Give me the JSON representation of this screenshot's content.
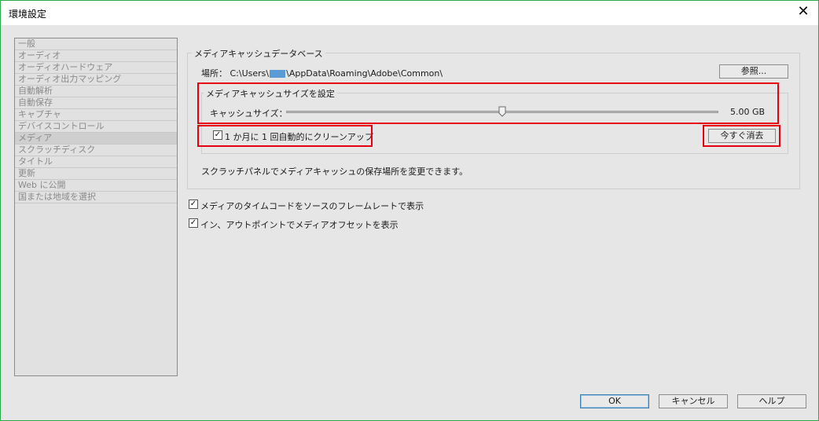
{
  "window": {
    "title": "環境設定",
    "close_glyph": "✕"
  },
  "sidebar": {
    "items": [
      {
        "label": "一般"
      },
      {
        "label": "オーディオ"
      },
      {
        "label": "オーディオハードウェア"
      },
      {
        "label": "オーディオ出力マッピング"
      },
      {
        "label": "自動解析"
      },
      {
        "label": "自動保存"
      },
      {
        "label": "キャプチャ"
      },
      {
        "label": "デバイスコントロール"
      },
      {
        "label": "メディア"
      },
      {
        "label": "スクラッチディスク"
      },
      {
        "label": "タイトル"
      },
      {
        "label": "更新"
      },
      {
        "label": "Web に公開"
      },
      {
        "label": "国または地域を選択"
      }
    ],
    "selected": "メディア"
  },
  "media_cache_db": {
    "group_title": "メディアキャッシュデータベース",
    "location_label": "場所：",
    "location_prefix": "C:\\Users\\",
    "location_suffix": "\\AppData\\Roaming\\Adobe\\Common\\",
    "browse_button": "参照..."
  },
  "cache_size": {
    "group_title": "メディアキャッシュサイズを設定",
    "size_label": "キャッシュサイズ：",
    "size_value": "5.00 GB",
    "slider_fraction": 0.5
  },
  "auto_clean": {
    "label": "1 か月に 1 回自動的にクリーンアップ",
    "checked": true,
    "clean_now_button": "今すぐ消去"
  },
  "scratch_note": "スクラッチパネルでメディアキャッシュの保存場所を変更できます。",
  "options": [
    {
      "label": "メディアのタイムコードをソースのフレームレートで表示",
      "checked": true
    },
    {
      "label": "イン、アウトポイントでメディアオフセットを表示",
      "checked": true
    }
  ],
  "footer": {
    "ok": "OK",
    "cancel": "キャンセル",
    "help": "ヘルプ"
  },
  "colors": {
    "highlight": "#e60012",
    "accent": "#3c7fb1"
  }
}
